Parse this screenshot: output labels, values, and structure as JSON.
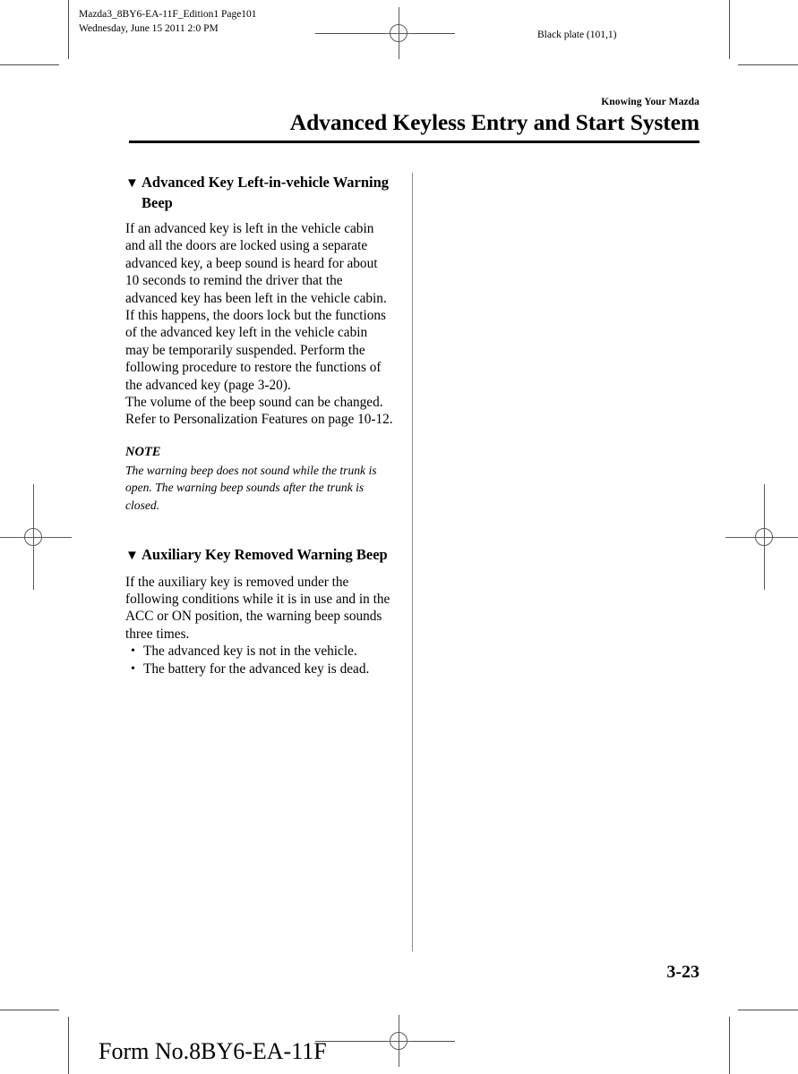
{
  "print_marks": {
    "slug_left_line1": "Mazda3_8BY6-EA-11F_Edition1 Page101",
    "slug_left_line2": "Wednesday, June 15 2011 2:0 PM",
    "slug_right": "Black plate (101,1)"
  },
  "header": {
    "running_head": "Knowing Your Mazda",
    "chapter_title": "Advanced Keyless Entry and Start System"
  },
  "content": {
    "section1": {
      "marker": "▼",
      "heading": "Advanced Key Left-in-vehicle Warning Beep",
      "paragraph1": "If an advanced key is left in the vehicle cabin and all the doors are locked using a separate advanced key, a beep sound is heard for about 10 seconds to remind the driver that the advanced key has been left in the vehicle cabin. If this happens, the doors lock but the functions of the advanced key left in the vehicle cabin may be temporarily suspended. Perform the following procedure to restore the functions of the advanced key (page 3-20).",
      "paragraph2": "The volume of the beep sound can be changed.",
      "paragraph3": "Refer to Personalization Features on page 10-12.",
      "note_label": "NOTE",
      "note_text": "The warning beep does not sound while the trunk is open. The warning beep sounds after the trunk is closed."
    },
    "section2": {
      "marker": "▼",
      "heading": "Auxiliary Key Removed Warning Beep",
      "paragraph1": "If the auxiliary key is removed under the following conditions while it is in use and in the ACC or ON position, the warning beep sounds three times.",
      "bullet_marker": "•",
      "bullets": [
        "The advanced key is not in the vehicle.",
        "The battery for the advanced key is dead."
      ]
    }
  },
  "footer": {
    "page_number": "3-23",
    "form_number": "Form No.8BY6-EA-11F"
  }
}
